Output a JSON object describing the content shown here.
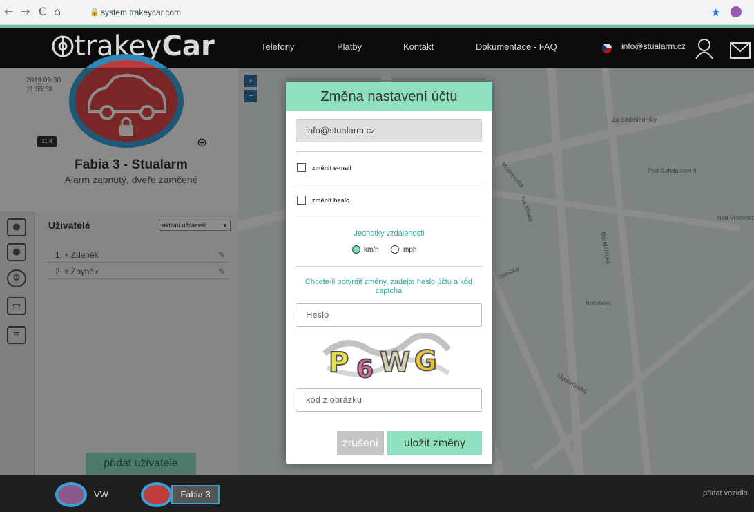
{
  "browser": {
    "url": "system.trakeycar.com",
    "glyphs": {
      "back": "←",
      "forward": "→",
      "reload": "C",
      "home": "⌂"
    }
  },
  "header": {
    "logo_prefix": "trakey",
    "logo_bold": "Car",
    "nav": [
      "Telefony",
      "Platby",
      "Kontakt",
      "Dokumentace - FAQ"
    ],
    "user_email": "info@stualarm.cz"
  },
  "vehicle": {
    "date": "2019.09.30",
    "time": "11:55:58",
    "battery": "11.6",
    "name": "Fabia 3 - Stualarm",
    "status": "Alarm zapnutý, dveře zamčené"
  },
  "users": {
    "title": "Uživatelé",
    "filter": "aktivní uživatelé",
    "rows": [
      {
        "index": "1.",
        "name": "Zdeněk"
      },
      {
        "index": "2.",
        "name": "Zbyněk"
      }
    ],
    "add_label": "přidat uživatele"
  },
  "map": {
    "labels": [
      "Za Sedmidomky",
      "Pod Bohdalcem II",
      "Nad Vršovskou",
      "Moskevská",
      "Na Křivce",
      "Osnická",
      "Bohdalecká",
      "Bohdalec",
      "Modletínská"
    ]
  },
  "bottom": {
    "vehicles": [
      "VW",
      "Fabia 3"
    ],
    "add_vehicle": "přidat vozidlo"
  },
  "modal": {
    "title": "Změna nastavení účtu",
    "email_value": "info@stualarm.cz",
    "change_email_label": "změnit e-mail",
    "change_password_label": "změnit heslo",
    "units_title": "Jednotky vzdálenosti",
    "units": [
      {
        "label": "km/h",
        "selected": true
      },
      {
        "label": "mph",
        "selected": false
      }
    ],
    "confirm_note": "Chcete-li potvrdit změny, zadejte heslo účtu a kód captcha",
    "password_placeholder": "Heslo",
    "captcha_text": "P6WG",
    "captcha_placeholder": "kód z obrázku",
    "cancel_label": "zrušení",
    "save_label": "uložit změny"
  },
  "colors": {
    "accent": "#8ee0c0",
    "badge_red": "#e04545",
    "ring_blue": "#3aa0d8",
    "header_bg": "#0f0f0f"
  }
}
